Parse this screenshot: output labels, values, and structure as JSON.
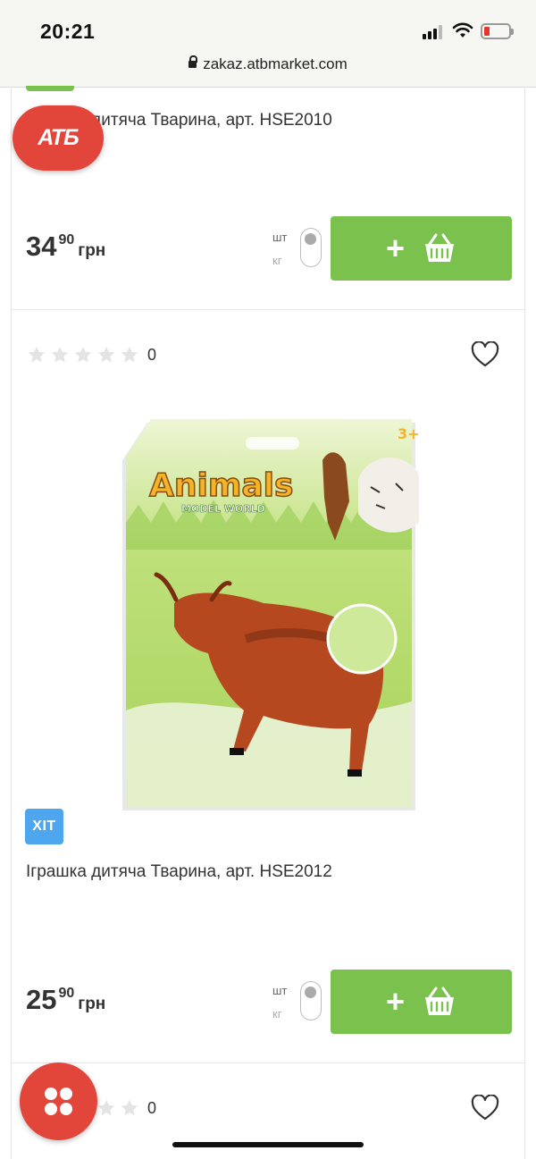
{
  "status_bar": {
    "time": "20:21",
    "url": "zakaz.atbmarket.com",
    "battery_color": "#e5352f"
  },
  "brand": {
    "logo_text": "АТБ",
    "accent": "#e2453a",
    "green": "#7bc14e",
    "badge_blue": "#4ea6ef"
  },
  "products": [
    {
      "title": "Іграшка дитяча Тварина, арт. HSE2010",
      "price_int": "34",
      "price_dec": "90",
      "currency": "грн",
      "unit_pcs": "шт",
      "unit_kg": "кг",
      "add_icon": "plus-icon",
      "basket_icon": "basket-icon"
    },
    {
      "rating_count": "0",
      "badge": "ХІТ",
      "title": "Іграшка дитяча Тварина, арт. HSE2012",
      "price_int": "25",
      "price_dec": "90",
      "currency": "грн",
      "unit_pcs": "шт",
      "unit_kg": "кг",
      "image_title": "Animals",
      "image_subtitle": "MODEL WORLD",
      "image_age": "3+"
    },
    {
      "rating_count": "0"
    }
  ]
}
